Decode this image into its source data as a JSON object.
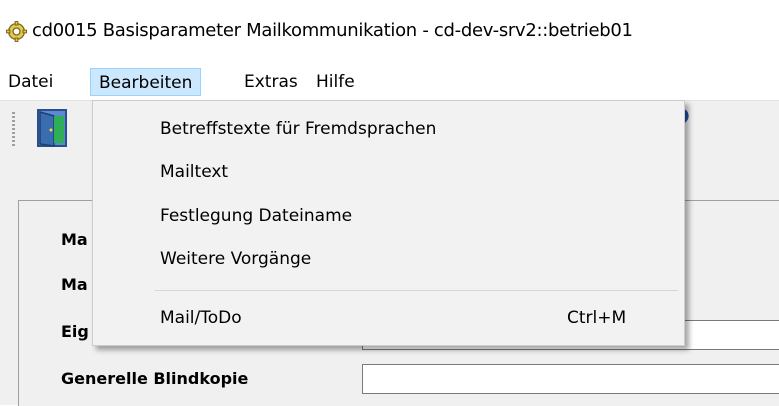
{
  "window": {
    "title": "cd0015 Basisparameter Mailkommunikation - cd-dev-srv2::betrieb01",
    "icon": "gear-icon"
  },
  "menubar": {
    "items": [
      {
        "label": "Datei"
      },
      {
        "label": "Bearbeiten"
      },
      {
        "label": "Extras"
      },
      {
        "label": "Hilfe"
      }
    ]
  },
  "toolbar": {
    "exit_icon": "door-exit-icon",
    "help_icon": "help-icon",
    "help_glyph": "?"
  },
  "dropdown": {
    "items": [
      {
        "label": "Betreffstexte für Fremdsprachen",
        "shortcut": ""
      },
      {
        "label": "Mailtext",
        "shortcut": ""
      },
      {
        "label": "Festlegung Dateiname",
        "shortcut": ""
      },
      {
        "label": "Weitere Vorgänge",
        "shortcut": ""
      },
      {
        "label": "Mail/ToDo",
        "shortcut": "Ctrl+M"
      }
    ]
  },
  "form": {
    "labels": [
      "Ma",
      "Ma",
      "Eig",
      "Generelle Blindkopie"
    ],
    "blind_copy_value": "",
    "field3_value": ""
  },
  "colors": {
    "menu_highlight": "#cce8ff",
    "help_blue": "#1e4fa8"
  }
}
